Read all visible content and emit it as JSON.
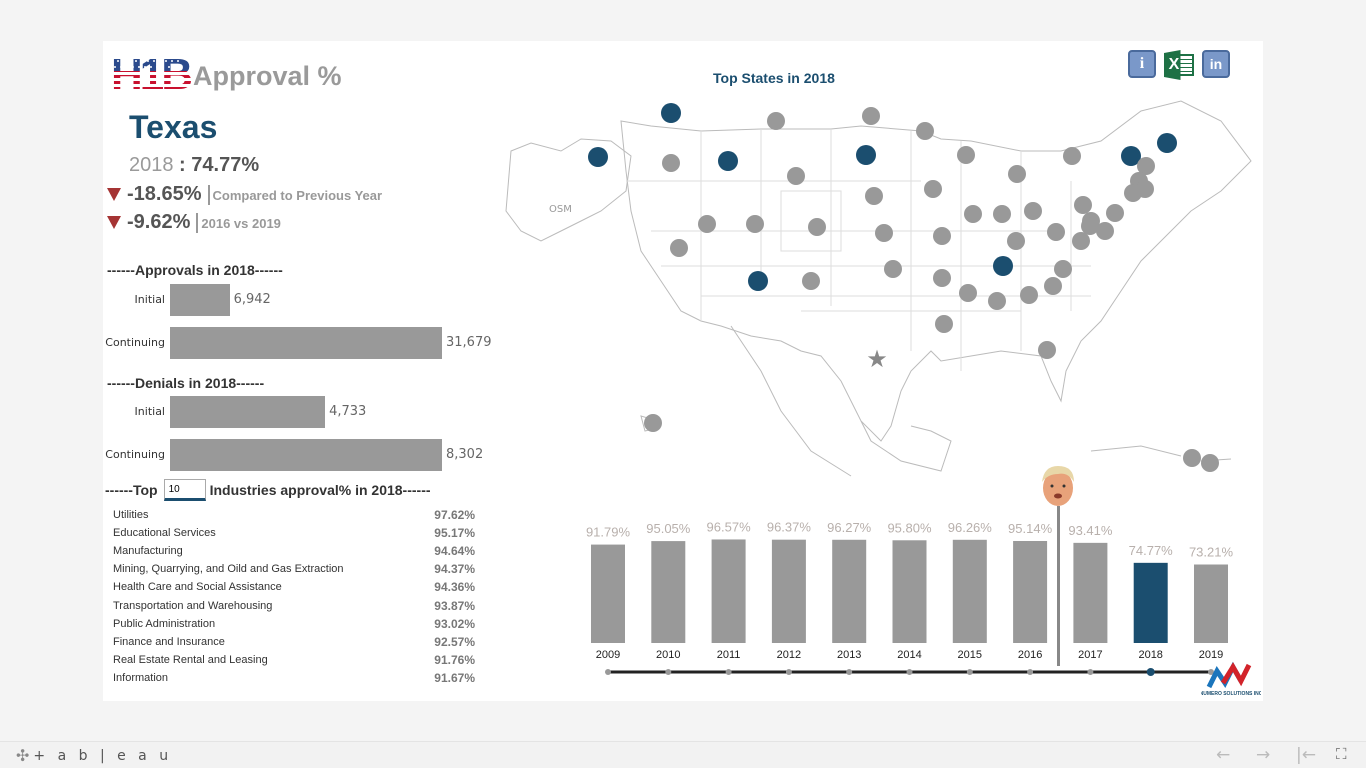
{
  "header": {
    "logo_text": "H1B",
    "title": "Approval %",
    "state": "Texas",
    "year": "2018",
    "year_sep": " : ",
    "approval_pct": "74.77%",
    "delta_prev": {
      "value": "-18.65%",
      "caption": "Compared to Previous Year",
      "direction": "down"
    },
    "delta_range": {
      "value": "-9.62%",
      "caption": "2016 vs 2019",
      "direction": "down"
    }
  },
  "approvals": {
    "heading": "------Approvals in 2018------",
    "rows": [
      {
        "label": "Initial",
        "value": 6942,
        "display": "6,942"
      },
      {
        "label": "Continuing",
        "value": 31679,
        "display": "31,679"
      }
    ]
  },
  "denials": {
    "heading": "------Denials in 2018------",
    "rows": [
      {
        "label": "Initial",
        "value": 4733,
        "display": "4,733"
      },
      {
        "label": "Continuing",
        "value": 8302,
        "display": "8,302"
      }
    ]
  },
  "industries": {
    "heading_prefix": "------Top",
    "top_n": "10",
    "heading_suffix": "Industries approval% in 2018------",
    "rows": [
      {
        "name": "Utilities",
        "pct": "97.62%"
      },
      {
        "name": "Educational Services",
        "pct": "95.17%"
      },
      {
        "name": "Manufacturing",
        "pct": "94.64%"
      },
      {
        "name": "Mining, Quarrying, and Oild and Gas Extraction",
        "pct": "94.37%"
      },
      {
        "name": "Health Care and Social Assistance",
        "pct": "94.36%"
      },
      {
        "name": "Transportation and Warehousing",
        "pct": "93.87%"
      },
      {
        "name": "Public Administration",
        "pct": "93.02%"
      },
      {
        "name": "Finance and Insurance",
        "pct": "92.57%"
      },
      {
        "name": "Real Estate Rental and Leasing",
        "pct": "91.76%"
      },
      {
        "name": "Information",
        "pct": "91.67%"
      }
    ]
  },
  "map": {
    "title": "Top States in 2018",
    "attribution": "OSM",
    "highlight_color": "#1b4e6f",
    "default_color": "#999999",
    "selected_marker": "star-icon"
  },
  "toolbar": {
    "info_label": "i",
    "excel_label": "X",
    "linkedin_label": "in"
  },
  "chart_data": {
    "type": "bar",
    "title": "",
    "xlabel": "",
    "ylabel": "Approval %",
    "categories": [
      "2009",
      "2010",
      "2011",
      "2012",
      "2013",
      "2014",
      "2015",
      "2016",
      "2017",
      "2018",
      "2019"
    ],
    "values": [
      91.79,
      95.05,
      96.57,
      96.37,
      96.27,
      95.8,
      96.26,
      95.14,
      93.41,
      74.77,
      73.21
    ],
    "labels": [
      "91.79%",
      "95.05%",
      "96.57%",
      "96.37%",
      "96.27%",
      "95.80%",
      "96.26%",
      "95.14%",
      "93.41%",
      "74.77%",
      "73.21%"
    ],
    "highlight": "2018",
    "highlight_color": "#1b4e6f",
    "bar_color": "#999999",
    "annotation": "Administration change marker between 2016 and 2017"
  },
  "slider": {
    "selected": "2018"
  },
  "brand": {
    "name": "NUMERO SOLUTIONS INC"
  },
  "footer": {
    "product": "+ a b | e a u",
    "back": "←",
    "forward": "→",
    "reset": "|←",
    "fullscreen": "⛶"
  }
}
